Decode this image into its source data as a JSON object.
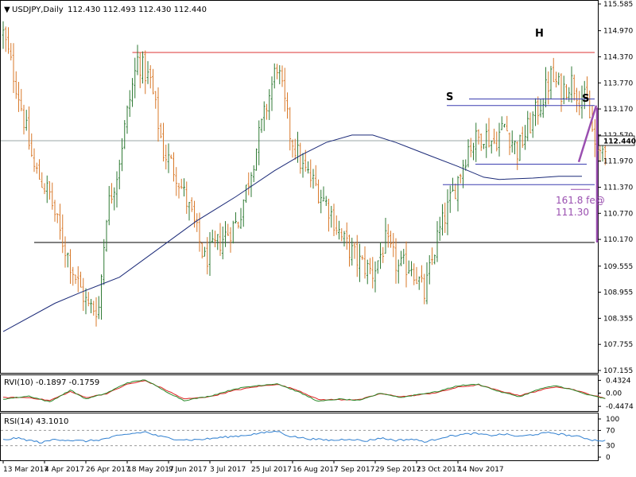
{
  "chart_data": {
    "type": "candlestick",
    "symbol_header": "USDJPY,Daily",
    "ohlc_header": "112.430 112.493 112.430 112.440",
    "last_price": "112.440",
    "price_axis_ticks": [
      "115.585",
      "114.970",
      "114.370",
      "113.770",
      "113.170",
      "112.570",
      "111.970",
      "111.370",
      "110.770",
      "110.170",
      "109.555",
      "108.955",
      "108.355",
      "107.755",
      "107.155"
    ],
    "price_ylim": [
      107.155,
      115.585
    ],
    "date_axis_ticks": [
      "13 Mar 2017",
      "4 Apr 2017",
      "26 Apr 2017",
      "18 May 2017",
      "9 Jun 2017",
      "3 Jul 2017",
      "25 Jul 2017",
      "16 Aug 2017",
      "7 Sep 2017",
      "29 Sep 2017",
      "23 Oct 2017",
      "14 Nov 2017"
    ],
    "annotations": {
      "left_shoulder": "S",
      "head": "H",
      "right_shoulder": "S",
      "fib_label": "161.8 fe@",
      "fib_value": "111.30"
    },
    "levels": {
      "resistance": 114.47,
      "support": 110.1,
      "neckline_upper": [
        113.25,
        113.4
      ],
      "neckline_lower": 111.43,
      "last": 112.44
    },
    "price_anchors": [
      [
        0,
        114.9
      ],
      [
        6,
        113.5
      ],
      [
        12,
        111.8
      ],
      [
        18,
        111.2
      ],
      [
        22,
        110.3
      ],
      [
        28,
        109.3
      ],
      [
        33,
        108.6
      ],
      [
        37,
        108.6
      ],
      [
        40,
        110.8
      ],
      [
        44,
        111.7
      ],
      [
        49,
        113.4
      ],
      [
        52,
        114.3
      ],
      [
        57,
        113.8
      ],
      [
        62,
        112.2
      ],
      [
        67,
        111.7
      ],
      [
        73,
        110.7
      ],
      [
        78,
        109.7
      ],
      [
        85,
        110.2
      ],
      [
        91,
        110.6
      ],
      [
        96,
        111.8
      ],
      [
        101,
        113.0
      ],
      [
        106,
        114.2
      ],
      [
        111,
        112.6
      ],
      [
        116,
        111.8
      ],
      [
        121,
        111.4
      ],
      [
        126,
        110.9
      ],
      [
        131,
        110.2
      ],
      [
        137,
        109.7
      ],
      [
        143,
        109.4
      ],
      [
        148,
        110.1
      ],
      [
        153,
        109.5
      ],
      [
        158,
        109.6
      ],
      [
        163,
        108.9
      ],
      [
        168,
        110.2
      ],
      [
        174,
        111.2
      ],
      [
        180,
        112.3
      ],
      [
        186,
        112.6
      ],
      [
        190,
        112.4
      ],
      [
        194,
        112.8
      ],
      [
        199,
        112.2
      ],
      [
        203,
        112.7
      ],
      [
        208,
        113.3
      ],
      [
        212,
        113.9
      ],
      [
        216,
        113.6
      ],
      [
        220,
        113.8
      ],
      [
        223,
        113.5
      ],
      [
        226,
        113.3
      ],
      [
        230,
        112.0
      ],
      [
        233,
        112.44
      ]
    ],
    "series": [
      {
        "name": "MA",
        "points": [
          [
            0,
            108.05
          ],
          [
            20,
            108.7
          ],
          [
            30,
            108.95
          ],
          [
            45,
            109.3
          ],
          [
            60,
            109.95
          ],
          [
            75,
            110.6
          ],
          [
            90,
            111.15
          ],
          [
            105,
            111.75
          ],
          [
            115,
            112.1
          ],
          [
            125,
            112.4
          ],
          [
            135,
            112.57
          ],
          [
            143,
            112.57
          ],
          [
            152,
            112.4
          ],
          [
            165,
            112.1
          ],
          [
            176,
            111.85
          ],
          [
            186,
            111.6
          ],
          [
            192,
            111.55
          ],
          [
            205,
            111.58
          ],
          [
            215,
            111.62
          ],
          [
            224,
            111.62
          ]
        ]
      }
    ],
    "indicators": [
      {
        "header": "RVI(10) -0.1897 -0.1759",
        "ticks": [
          "0.4324",
          "0.00",
          "-0.4474"
        ],
        "ylim": [
          -0.55,
          0.55
        ],
        "main": [
          [
            0,
            -0.2
          ],
          [
            10,
            -0.1
          ],
          [
            18,
            -0.3
          ],
          [
            26,
            0.1
          ],
          [
            32,
            -0.2
          ],
          [
            40,
            0.0
          ],
          [
            48,
            0.35
          ],
          [
            55,
            0.45
          ],
          [
            62,
            0.1
          ],
          [
            70,
            -0.25
          ],
          [
            80,
            -0.1
          ],
          [
            90,
            0.15
          ],
          [
            98,
            0.25
          ],
          [
            106,
            0.32
          ],
          [
            114,
            0.05
          ],
          [
            122,
            -0.28
          ],
          [
            130,
            -0.2
          ],
          [
            138,
            -0.25
          ],
          [
            146,
            0.0
          ],
          [
            154,
            -0.15
          ],
          [
            160,
            -0.05
          ],
          [
            168,
            0.05
          ],
          [
            176,
            0.25
          ],
          [
            184,
            0.3
          ],
          [
            192,
            0.05
          ],
          [
            200,
            -0.12
          ],
          [
            208,
            0.15
          ],
          [
            214,
            0.25
          ],
          [
            220,
            0.12
          ],
          [
            226,
            -0.05
          ],
          [
            233,
            -0.19
          ]
        ],
        "signal": [
          [
            0,
            -0.15
          ],
          [
            10,
            -0.15
          ],
          [
            18,
            -0.25
          ],
          [
            26,
            0.05
          ],
          [
            32,
            -0.15
          ],
          [
            40,
            -0.02
          ],
          [
            48,
            0.3
          ],
          [
            55,
            0.42
          ],
          [
            62,
            0.15
          ],
          [
            70,
            -0.2
          ],
          [
            80,
            -0.12
          ],
          [
            90,
            0.1
          ],
          [
            98,
            0.22
          ],
          [
            106,
            0.3
          ],
          [
            114,
            0.1
          ],
          [
            122,
            -0.22
          ],
          [
            130,
            -0.22
          ],
          [
            138,
            -0.22
          ],
          [
            146,
            -0.02
          ],
          [
            154,
            -0.12
          ],
          [
            160,
            -0.07
          ],
          [
            168,
            0.02
          ],
          [
            176,
            0.2
          ],
          [
            184,
            0.28
          ],
          [
            192,
            0.08
          ],
          [
            200,
            -0.08
          ],
          [
            208,
            0.1
          ],
          [
            214,
            0.22
          ],
          [
            220,
            0.14
          ],
          [
            226,
            -0.02
          ],
          [
            233,
            -0.18
          ]
        ]
      },
      {
        "header": "RSI(14) 43.1010",
        "ticks": [
          "100",
          "70",
          "30",
          "0"
        ],
        "ylim": [
          0,
          100
        ],
        "levels": [
          70,
          30
        ],
        "values": [
          [
            0,
            45
          ],
          [
            5,
            50
          ],
          [
            10,
            44
          ],
          [
            15,
            38
          ],
          [
            20,
            47
          ],
          [
            26,
            44
          ],
          [
            32,
            42
          ],
          [
            38,
            46
          ],
          [
            44,
            55
          ],
          [
            50,
            62
          ],
          [
            55,
            66
          ],
          [
            60,
            55
          ],
          [
            66,
            48
          ],
          [
            72,
            45
          ],
          [
            78,
            47
          ],
          [
            85,
            52
          ],
          [
            92,
            56
          ],
          [
            100,
            63
          ],
          [
            106,
            68
          ],
          [
            111,
            55
          ],
          [
            116,
            50
          ],
          [
            122,
            46
          ],
          [
            128,
            44
          ],
          [
            134,
            48
          ],
          [
            140,
            42
          ],
          [
            146,
            50
          ],
          [
            152,
            44
          ],
          [
            158,
            47
          ],
          [
            164,
            40
          ],
          [
            170,
            52
          ],
          [
            176,
            58
          ],
          [
            182,
            62
          ],
          [
            188,
            57
          ],
          [
            194,
            60
          ],
          [
            200,
            54
          ],
          [
            206,
            60
          ],
          [
            212,
            64
          ],
          [
            218,
            58
          ],
          [
            224,
            52
          ],
          [
            228,
            45
          ],
          [
            233,
            43
          ]
        ]
      }
    ]
  }
}
